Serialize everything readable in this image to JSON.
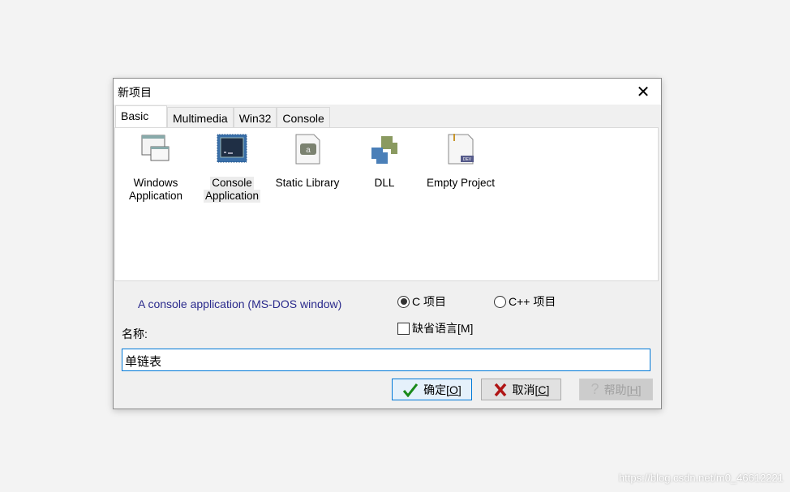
{
  "dialog": {
    "title": "新项目",
    "close": "✕"
  },
  "tabs": [
    {
      "label": "Basic",
      "active": true
    },
    {
      "label": "Multimedia"
    },
    {
      "label": "Win32"
    },
    {
      "label": "Console"
    }
  ],
  "templates": [
    {
      "line1": "Windows",
      "line2": "Application",
      "icon": "windows-app-icon"
    },
    {
      "line1": "Console",
      "line2": "Application",
      "icon": "console-app-icon",
      "selected": true
    },
    {
      "line1": "Static Library",
      "line2": "",
      "icon": "static-library-icon"
    },
    {
      "line1": "DLL",
      "line2": "",
      "icon": "dll-puzzle-icon"
    },
    {
      "line1": "Empty Project",
      "line2": "",
      "icon": "empty-project-icon"
    }
  ],
  "description": "A console application (MS-DOS window)",
  "language": {
    "c": "C 项目",
    "cpp": "C++ 项目",
    "selected": "c"
  },
  "default_lang": {
    "label": "缺省语言[M]",
    "checked": false
  },
  "name": {
    "label": "名称:",
    "value": "单链表"
  },
  "buttons": {
    "ok": "确定",
    "ok_key": "[O]",
    "cancel": "取消",
    "cancel_key": "[C]",
    "help": "帮助",
    "help_key": "[H]"
  },
  "watermark": "https://blog.csdn.net/m0_46612221"
}
